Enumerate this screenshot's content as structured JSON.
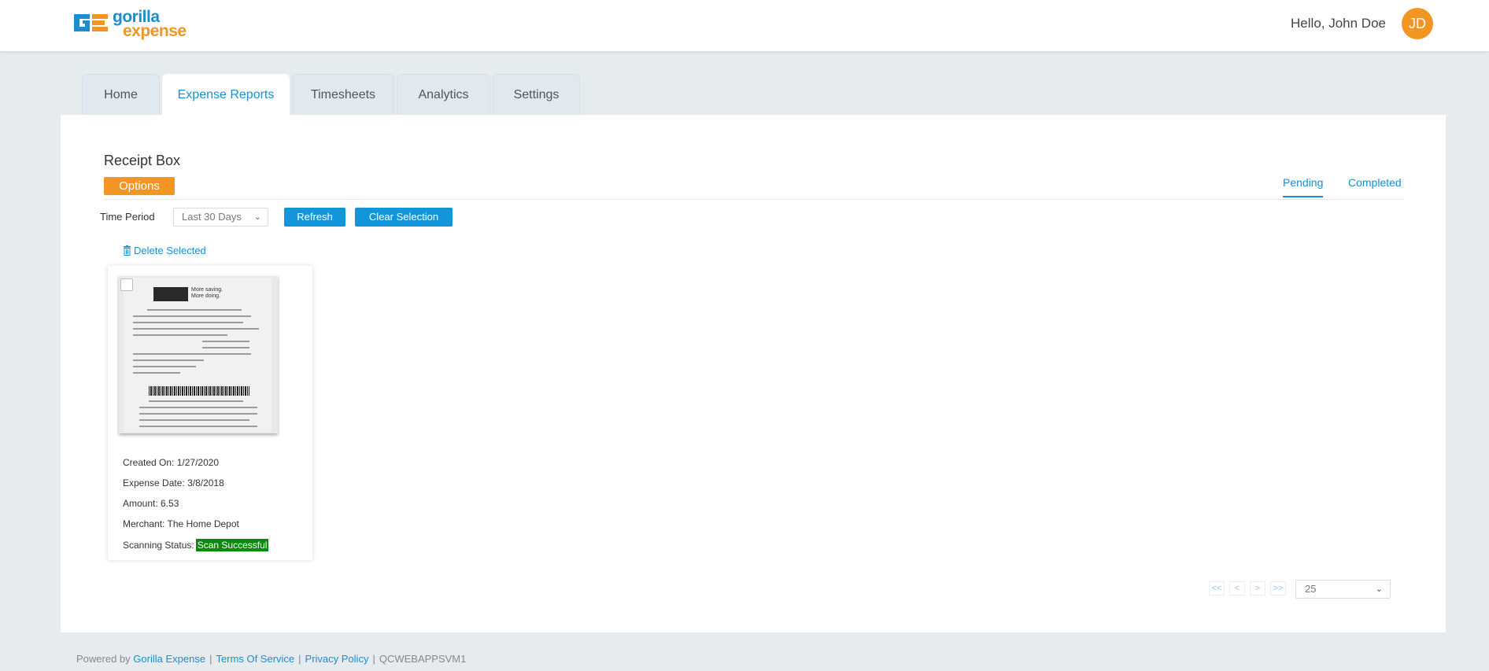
{
  "header": {
    "logo_line1": "gorilla",
    "logo_line2": "expense",
    "greeting": "Hello, John Doe",
    "avatar_initials": "JD"
  },
  "tabs": [
    {
      "label": "Home",
      "active": false
    },
    {
      "label": "Expense Reports",
      "active": true
    },
    {
      "label": "Timesheets",
      "active": false
    },
    {
      "label": "Analytics",
      "active": false
    },
    {
      "label": "Settings",
      "active": false
    }
  ],
  "receipt_box": {
    "title": "Receipt Box",
    "options_label": "Options",
    "view_tabs": {
      "pending": "Pending",
      "completed": "Completed"
    },
    "time_period_label": "Time Period",
    "time_period_value": "Last 30 Days",
    "refresh_label": "Refresh",
    "clear_selection_label": "Clear Selection",
    "delete_selected_label": "Delete Selected"
  },
  "receipts": [
    {
      "created_on_label": "Created On:",
      "created_on": "1/27/2020",
      "expense_date_label": "Expense Date:",
      "expense_date": "3/8/2018",
      "amount_label": "Amount:",
      "amount": "6.53",
      "merchant_label": "Merchant:",
      "merchant": "The Home Depot",
      "scanning_status_label": "Scanning Status:",
      "scanning_status": "Scan Successful",
      "image_text": "More saving. More doing."
    }
  ],
  "pagination": {
    "first": "<<",
    "prev": "<",
    "next": ">",
    "last": ">>",
    "page_size": "25"
  },
  "footer": {
    "powered_by": "Powered by",
    "brand_link": "Gorilla Expense",
    "terms_link": "Terms Of Service",
    "privacy_link": "Privacy Policy",
    "server": "QCWEBAPPSVM1"
  },
  "colors": {
    "brand_blue": "#1a8ed1",
    "brand_orange": "#f29523",
    "button_blue": "#1396d9",
    "success_green": "#0a8a0a",
    "page_bg": "#e6ebee"
  }
}
